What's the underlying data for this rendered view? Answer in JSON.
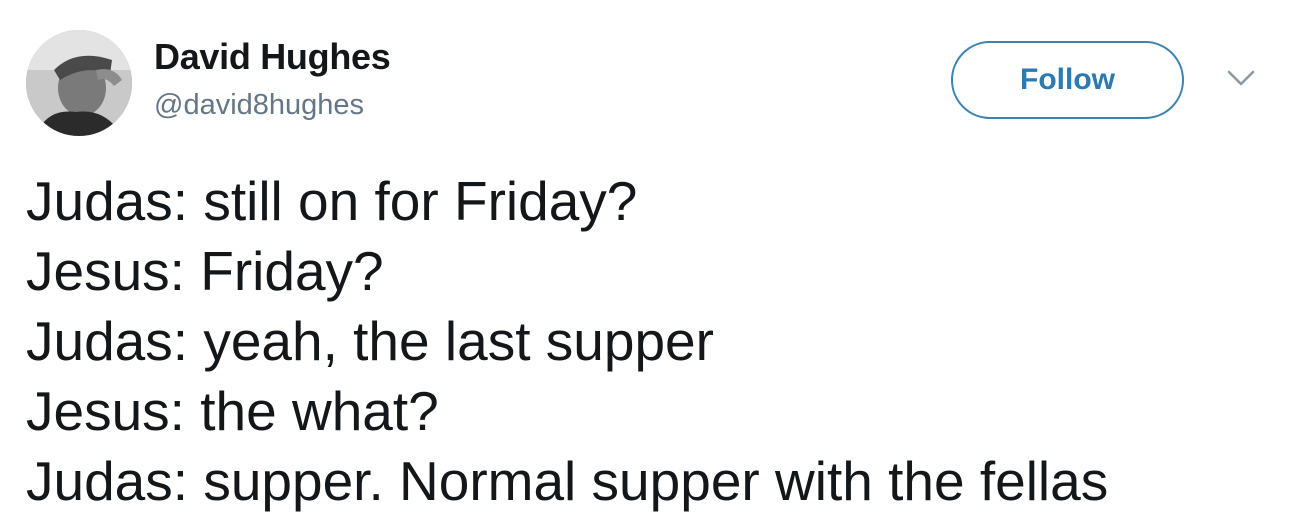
{
  "author": {
    "name": "David Hughes",
    "handle": "@david8hughes"
  },
  "follow_button": {
    "label": "Follow"
  },
  "menu": {
    "icon": "chevron-down-icon"
  },
  "tweet": {
    "lines": [
      "Judas: still on for Friday?",
      "Jesus: Friday?",
      "Judas: yeah, the last supper",
      "Jesus: the what?",
      "Judas: supper. Normal supper with the fellas"
    ]
  },
  "colors": {
    "text": "#14171a",
    "handle": "#657786",
    "accent": "#2b7bb0",
    "chevron": "#8899a6"
  }
}
